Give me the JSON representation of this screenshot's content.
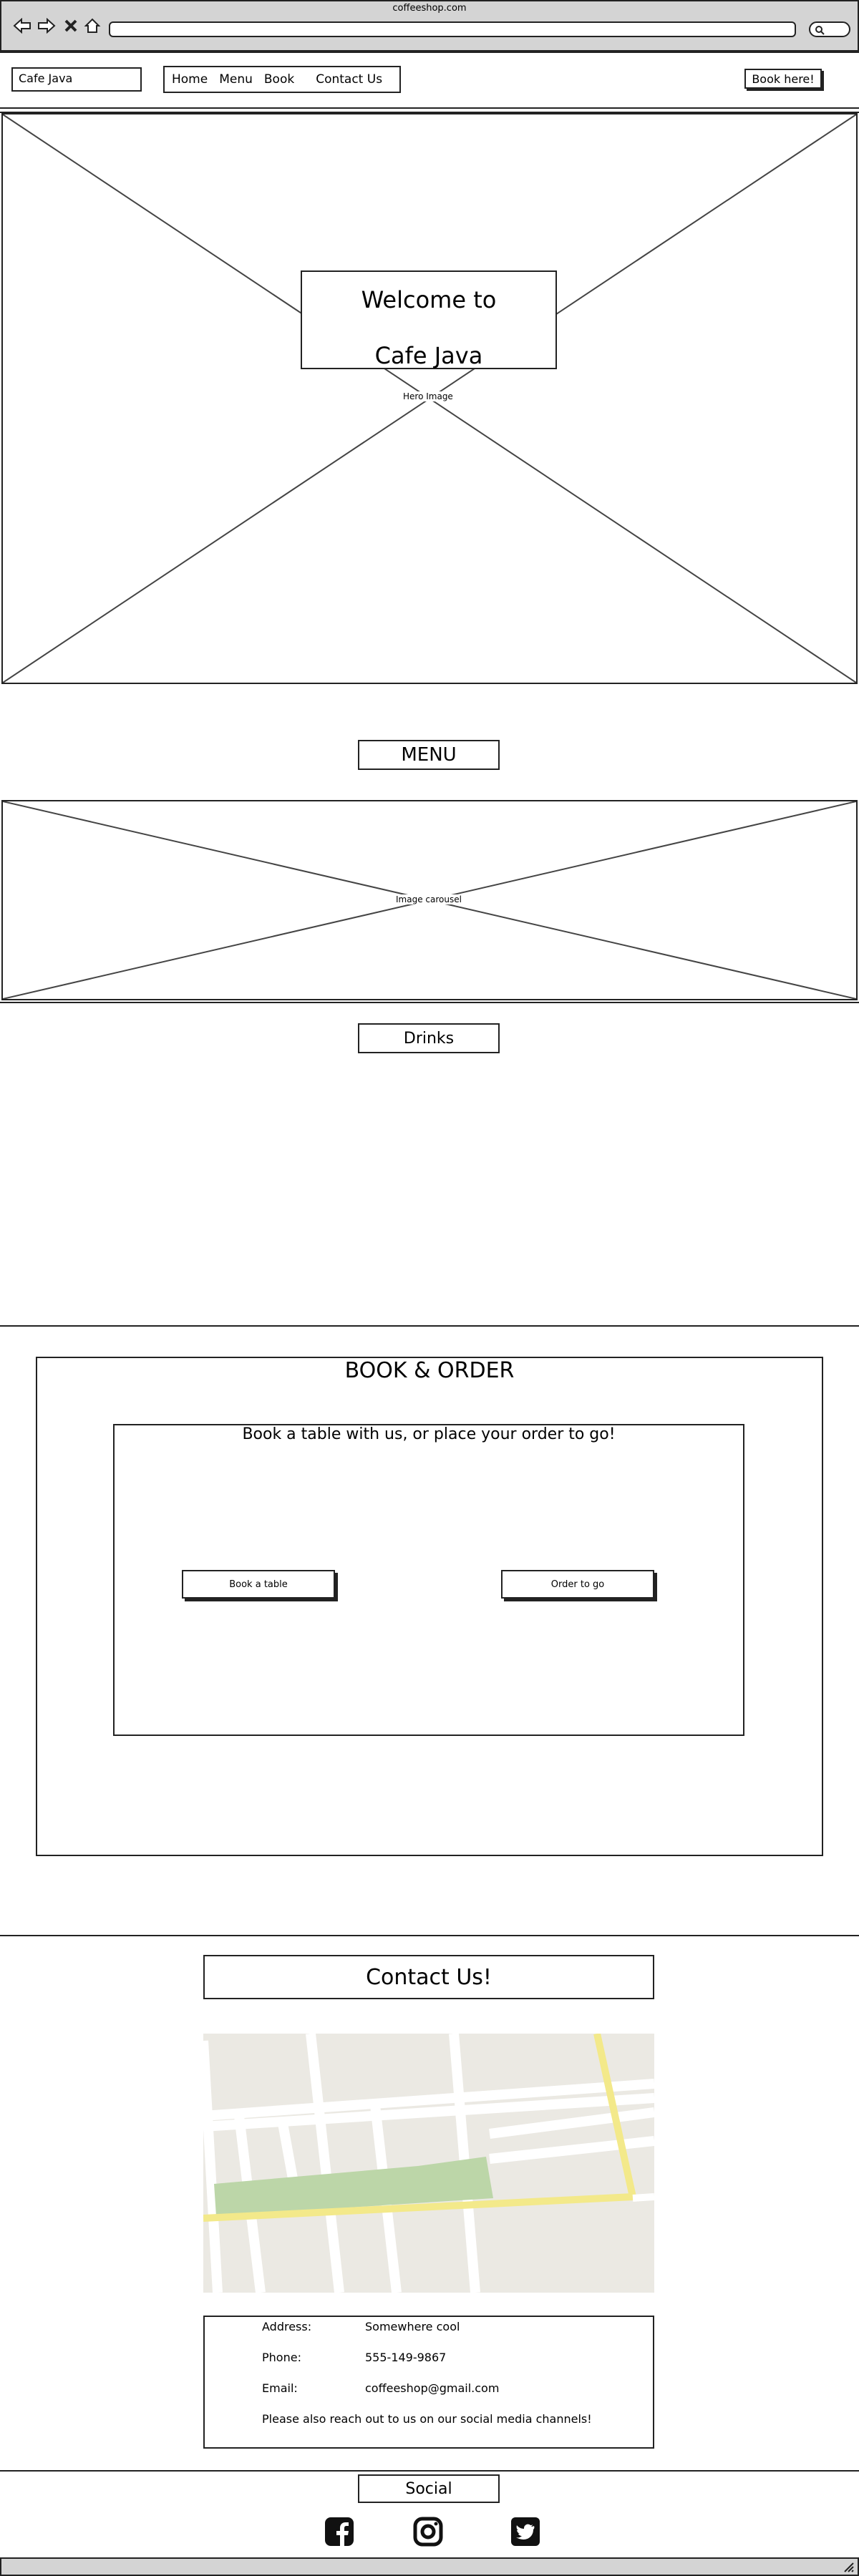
{
  "browser": {
    "url_title": "coffeeshop.com",
    "nav_icons": [
      "back-icon",
      "forward-icon",
      "close-icon",
      "home-icon"
    ],
    "search_icon": "search-icon"
  },
  "header": {
    "brand": "Cafe Java",
    "nav": [
      "Home",
      "Menu",
      "Book",
      "Contact Us"
    ],
    "cta": "Book here!"
  },
  "hero": {
    "title_line1": "Welcome to",
    "title_line2": "Cafe Java",
    "image_label": "Hero Image"
  },
  "menu": {
    "heading": "MENU",
    "carousel_label": "Image carousel",
    "drinks_heading": "Drinks"
  },
  "book_order": {
    "heading": "BOOK & ORDER",
    "subheading": "Book a table with us, or place your order to go!",
    "book_button": "Book a table",
    "order_button": "Order to go"
  },
  "contact": {
    "heading": "Contact Us!",
    "address_label": "Address:",
    "address_value": "Somewhere cool",
    "phone_label": "Phone:",
    "phone_value": "555-149-9867",
    "email_label": "Email:",
    "email_value": "coffeeshop@gmail.com",
    "note": "Please also reach out to us on our social media channels!"
  },
  "social": {
    "heading": "Social",
    "icons": [
      "facebook-icon",
      "instagram-icon",
      "twitter-icon"
    ]
  },
  "colors": {
    "map_bg": "#ebe9e3",
    "map_park": "#bcd6a8",
    "map_road_major": "#f3e98a",
    "chrome_bg": "#d4d4d4"
  }
}
